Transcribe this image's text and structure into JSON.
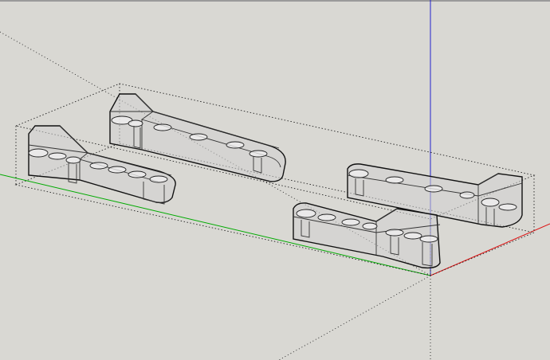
{
  "viewport": {
    "background": "#d9d8d3",
    "axis_colors": {
      "red": "#d11",
      "green": "#0a0",
      "blue": "#22c"
    }
  },
  "scene": {
    "model_type": "3d-model",
    "selection_box": "dotted-bounding-box",
    "parts": [
      {
        "id": "bracket-left-front"
      },
      {
        "id": "bracket-left-back"
      },
      {
        "id": "bracket-right-back"
      },
      {
        "id": "bracket-right-front"
      }
    ]
  }
}
